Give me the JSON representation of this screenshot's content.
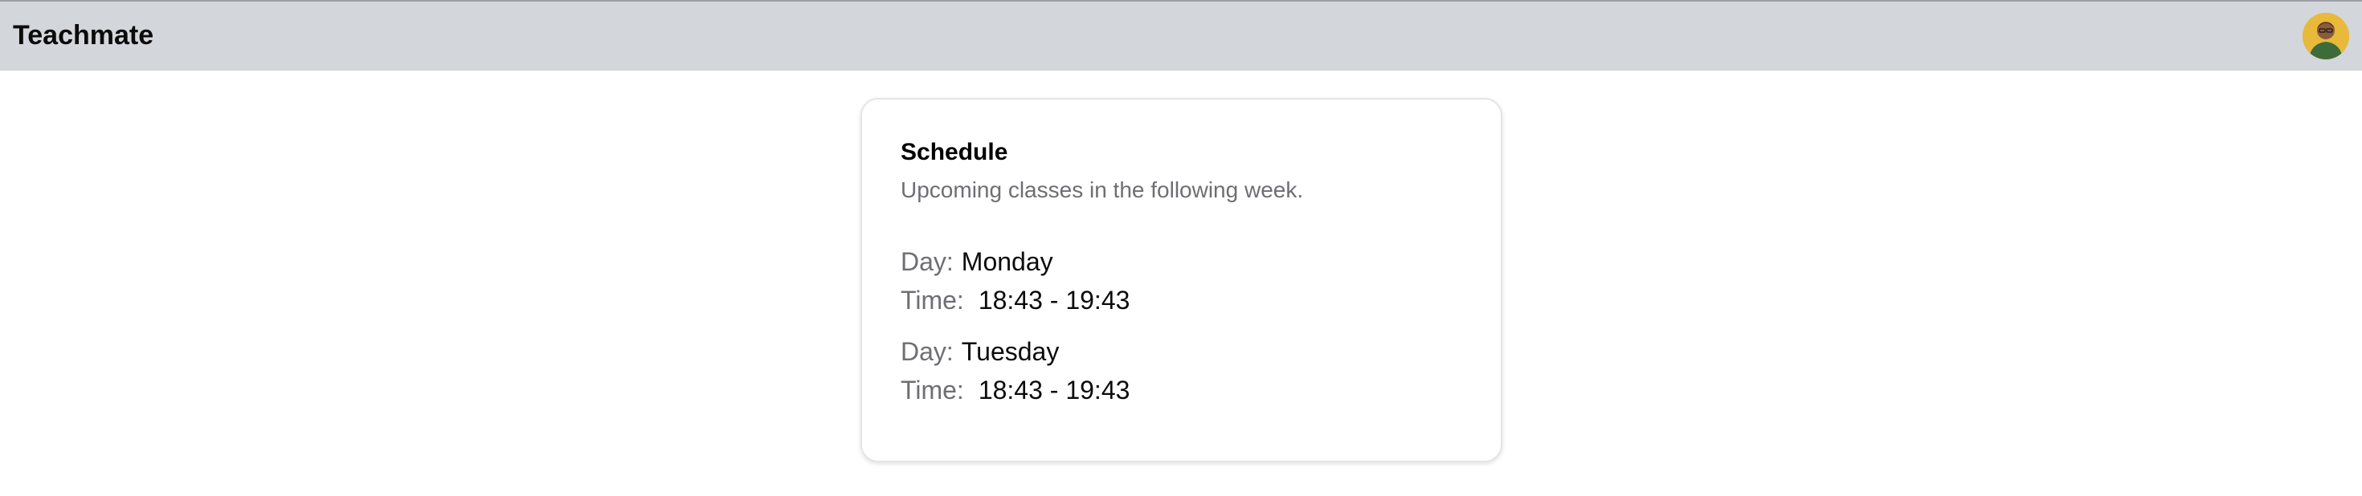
{
  "header": {
    "app_title": "Teachmate",
    "avatar_icon": "user-avatar-icon"
  },
  "schedule": {
    "title": "Schedule",
    "subtitle": "Upcoming classes in the following week.",
    "day_label": "Day:",
    "time_label": "Time:",
    "entries": [
      {
        "day": "Monday",
        "time": "18:43 - 19:43"
      },
      {
        "day": "Tuesday",
        "time": "18:43 - 19:43"
      }
    ]
  },
  "colors": {
    "header_bg": "#d3d6da",
    "muted_text": "#6e6e73",
    "avatar_bg": "#e8b93a"
  }
}
